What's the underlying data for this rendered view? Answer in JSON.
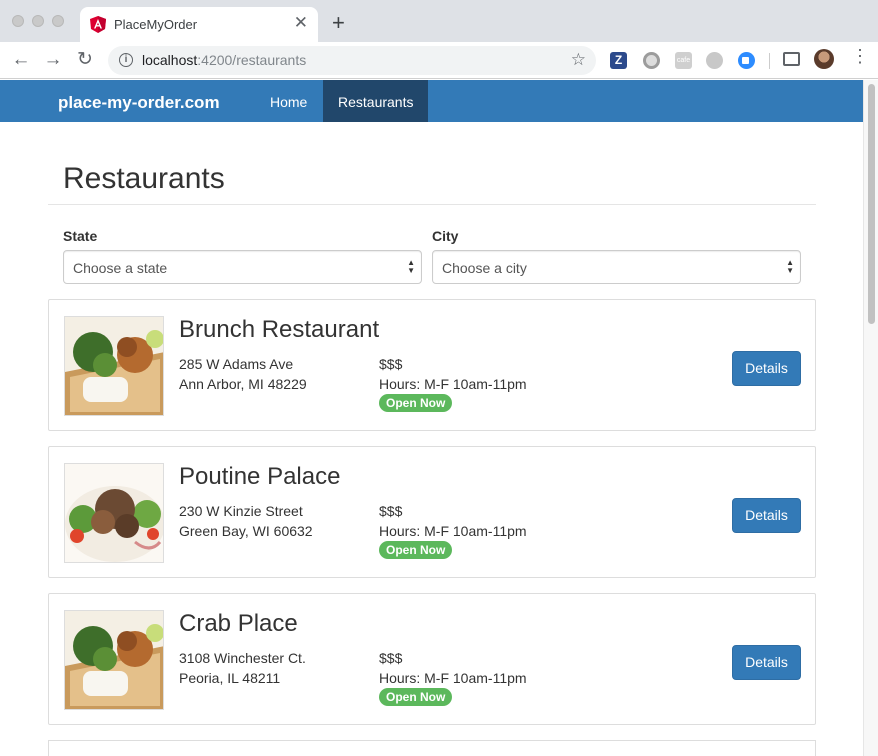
{
  "browser": {
    "tab_title": "PlaceMyOrder",
    "url_host": "localhost",
    "url_rest": ":4200/restaurants",
    "extension_z": "Z",
    "extension_c": "cafe"
  },
  "navbar": {
    "brand": "place-my-order.com",
    "links": [
      {
        "label": "Home",
        "active": false
      },
      {
        "label": "Restaurants",
        "active": true
      }
    ],
    "color": "#337ab7",
    "active_color": "#21476b"
  },
  "page": {
    "title": "Restaurants",
    "state": {
      "label": "State",
      "placeholder": "Choose a state"
    },
    "city": {
      "label": "City",
      "placeholder": "Choose a city"
    }
  },
  "restaurants": [
    {
      "name": "Brunch Restaurant",
      "street": "285 W Adams Ave",
      "city_line": "Ann Arbor, MI 48229",
      "price": "$$$",
      "hours": "Hours: M-F 10am-11pm",
      "status": "Open Now",
      "button": "Details",
      "image": "salmon-rice-dish"
    },
    {
      "name": "Poutine Palace",
      "street": "230 W Kinzie Street",
      "city_line": "Green Bay, WI 60632",
      "price": "$$$",
      "hours": "Hours: M-F 10am-11pm",
      "status": "Open Now",
      "button": "Details",
      "image": "steak-salad-dish"
    },
    {
      "name": "Crab Place",
      "street": "3108 Winchester Ct.",
      "city_line": "Peoria, IL 48211",
      "price": "$$$",
      "hours": "Hours: M-F 10am-11pm",
      "status": "Open Now",
      "button": "Details",
      "image": "salmon-rice-dish"
    }
  ],
  "colors": {
    "open_badge": "#5cb85c",
    "button": "#337ab7"
  }
}
